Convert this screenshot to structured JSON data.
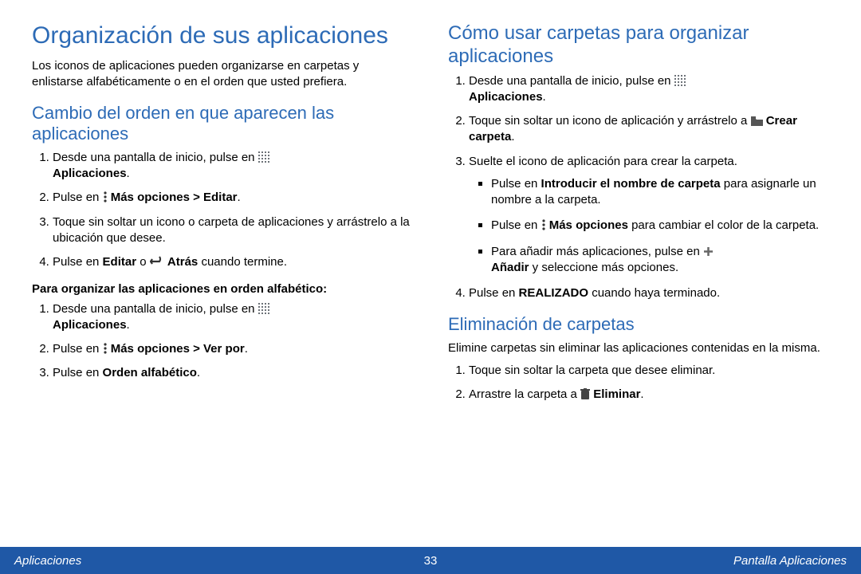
{
  "left": {
    "h1": "Organización de sus aplicaciones",
    "intro": "Los iconos de aplicaciones pueden organizarse en carpetas y enlistarse alfabéticamente o en el orden que usted prefiera.",
    "h2a": "Cambio del orden en que aparecen las aplicaciones",
    "s1": {
      "pre": "Desde una pantalla de inicio, pulse en ",
      "post": "Aplicaciones"
    },
    "s2": {
      "pre": "Pulse en ",
      "post": "Más opciones > Editar"
    },
    "s3": "Toque sin soltar un icono o carpeta de aplicaciones y arrástrelo a la ubicación que desee.",
    "s4": {
      "pre": "Pulse en ",
      "mid": "Editar",
      "mid2": " o ",
      "post": "Atrás",
      "tail": " cuando termine."
    },
    "sub": "Para organizar las aplicaciones en orden alfabético:",
    "a1": {
      "pre": "Desde una pantalla de inicio, pulse en ",
      "post": "Aplicaciones"
    },
    "a2": {
      "pre": "Pulse en ",
      "post": "Más opciones > Ver por"
    },
    "a3": {
      "pre": "Pulse en ",
      "post": "Orden alfabético"
    }
  },
  "right": {
    "h2b": "Cómo usar carpetas para organizar aplicaciones",
    "f1": {
      "pre": "Desde una pantalla de inicio, pulse en ",
      "post": "Aplicaciones"
    },
    "f2": {
      "pre": "Toque sin soltar un icono de aplicación y arrástrelo a ",
      "post": "Crear carpeta"
    },
    "f3": "Suelte el icono de aplicación para crear la carpeta.",
    "b1": {
      "pre": "Pulse en ",
      "bold": "Introducir el nombre de carpeta",
      "post": " para asignarle un nombre a la carpeta."
    },
    "b2": {
      "pre": "Pulse en ",
      "bold": "Más opciones",
      "post": " para cambiar el color de la carpeta."
    },
    "b3": {
      "pre": "Para añadir más aplicaciones, pulse en ",
      "bold": "Añadir",
      "post": " y seleccione más opciones."
    },
    "f4": {
      "pre": "Pulse en ",
      "bold": "REALIZADO",
      "post": " cuando haya terminado."
    },
    "h2c": "Eliminación de carpetas",
    "del_intro": "Elimine carpetas sin eliminar las aplicaciones contenidas en la misma.",
    "d1": "Toque sin soltar la carpeta que desee eliminar.",
    "d2": {
      "pre": "Arrastre la carpeta a ",
      "post": "Eliminar"
    }
  },
  "footer": {
    "left": "Aplicaciones",
    "page": "33",
    "right": "Pantalla Aplicaciones"
  }
}
